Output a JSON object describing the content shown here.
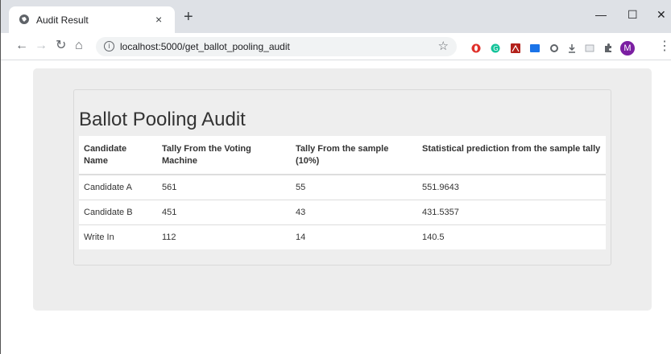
{
  "browser": {
    "tab_title": "Audit Result",
    "tab_close": "×",
    "new_tab": "+",
    "url": "localhost:5000/get_ballot_pooling_audit",
    "window_minimize": "—",
    "window_maximize": "☐",
    "window_close": "✕",
    "profile_initial": "M"
  },
  "page": {
    "heading": "Ballot Pooling Audit",
    "table": {
      "headers": [
        "Candidate Name",
        "Tally From the Voting Machine",
        "Tally From the sample (10%)",
        "Statistical prediction from the sample tally"
      ],
      "rows": [
        [
          "Candidate A",
          "561",
          "55",
          "551.9643"
        ],
        [
          "Candidate B",
          "451",
          "43",
          "431.5357"
        ],
        [
          "Write In",
          "112",
          "14",
          "140.5"
        ]
      ]
    }
  },
  "colors": {
    "accent": "#7b1fa2",
    "tabstrip": "#dee1e6"
  }
}
